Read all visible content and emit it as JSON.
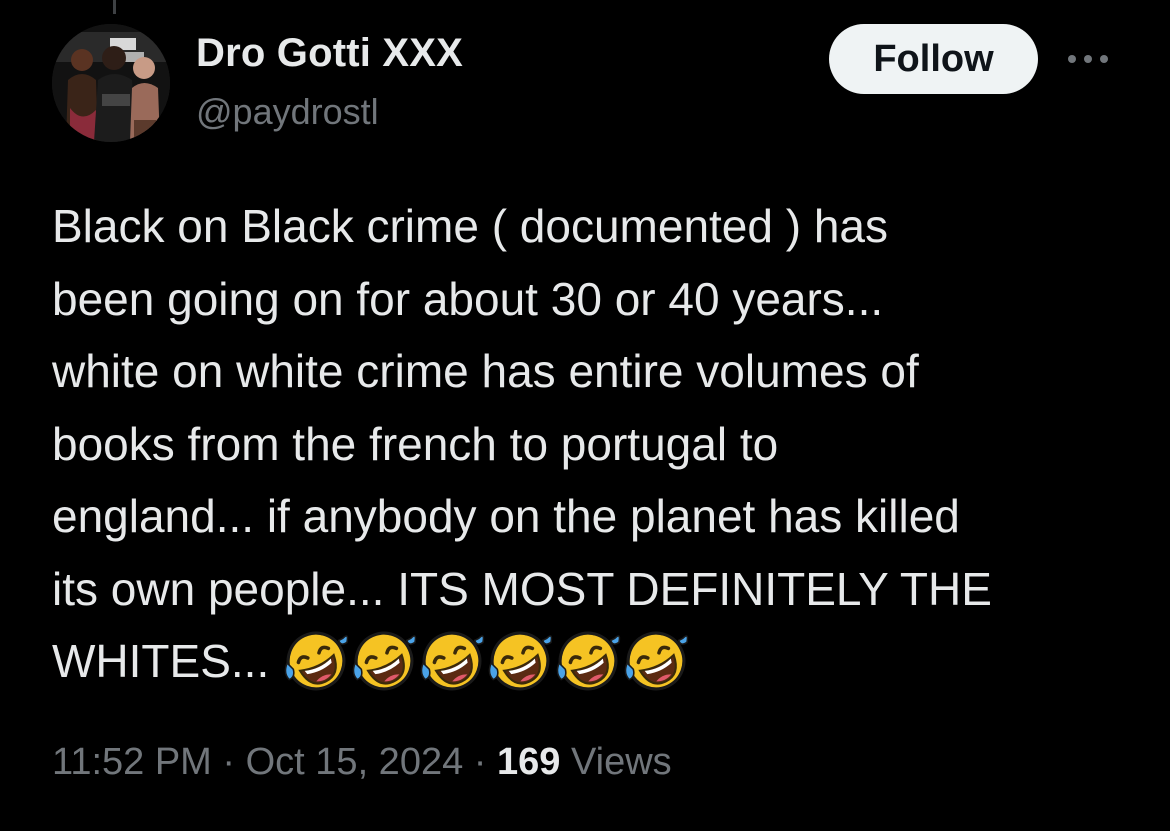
{
  "author": {
    "display_name": "Dro Gotti XXX",
    "handle": "@paydrostl"
  },
  "actions": {
    "follow_label": "Follow",
    "more_icon": "more-horizontal-icon"
  },
  "tweet": {
    "lines": [
      "Black on Black crime ( documented ) has",
      "been going on for about 30 or 40 years...",
      "white on white crime has entire volumes of",
      "books from the french to portugal to",
      "england... if anybody on the planet has killed",
      "its own people... ITS MOST DEFINITELY THE",
      "WHITES..."
    ],
    "emoji_count": 6,
    "emoji_name": "rolling-on-the-floor-laughing-emoji"
  },
  "meta": {
    "time": "11:52 PM",
    "separator": " · ",
    "date": "Oct 15, 2024",
    "views_count": "169",
    "views_label": " Views"
  },
  "colors": {
    "background": "#000000",
    "primary_text": "#e7e9ea",
    "secondary_text": "#71767b",
    "follow_button_bg": "#eff3f4",
    "follow_button_text": "#0f1419"
  }
}
